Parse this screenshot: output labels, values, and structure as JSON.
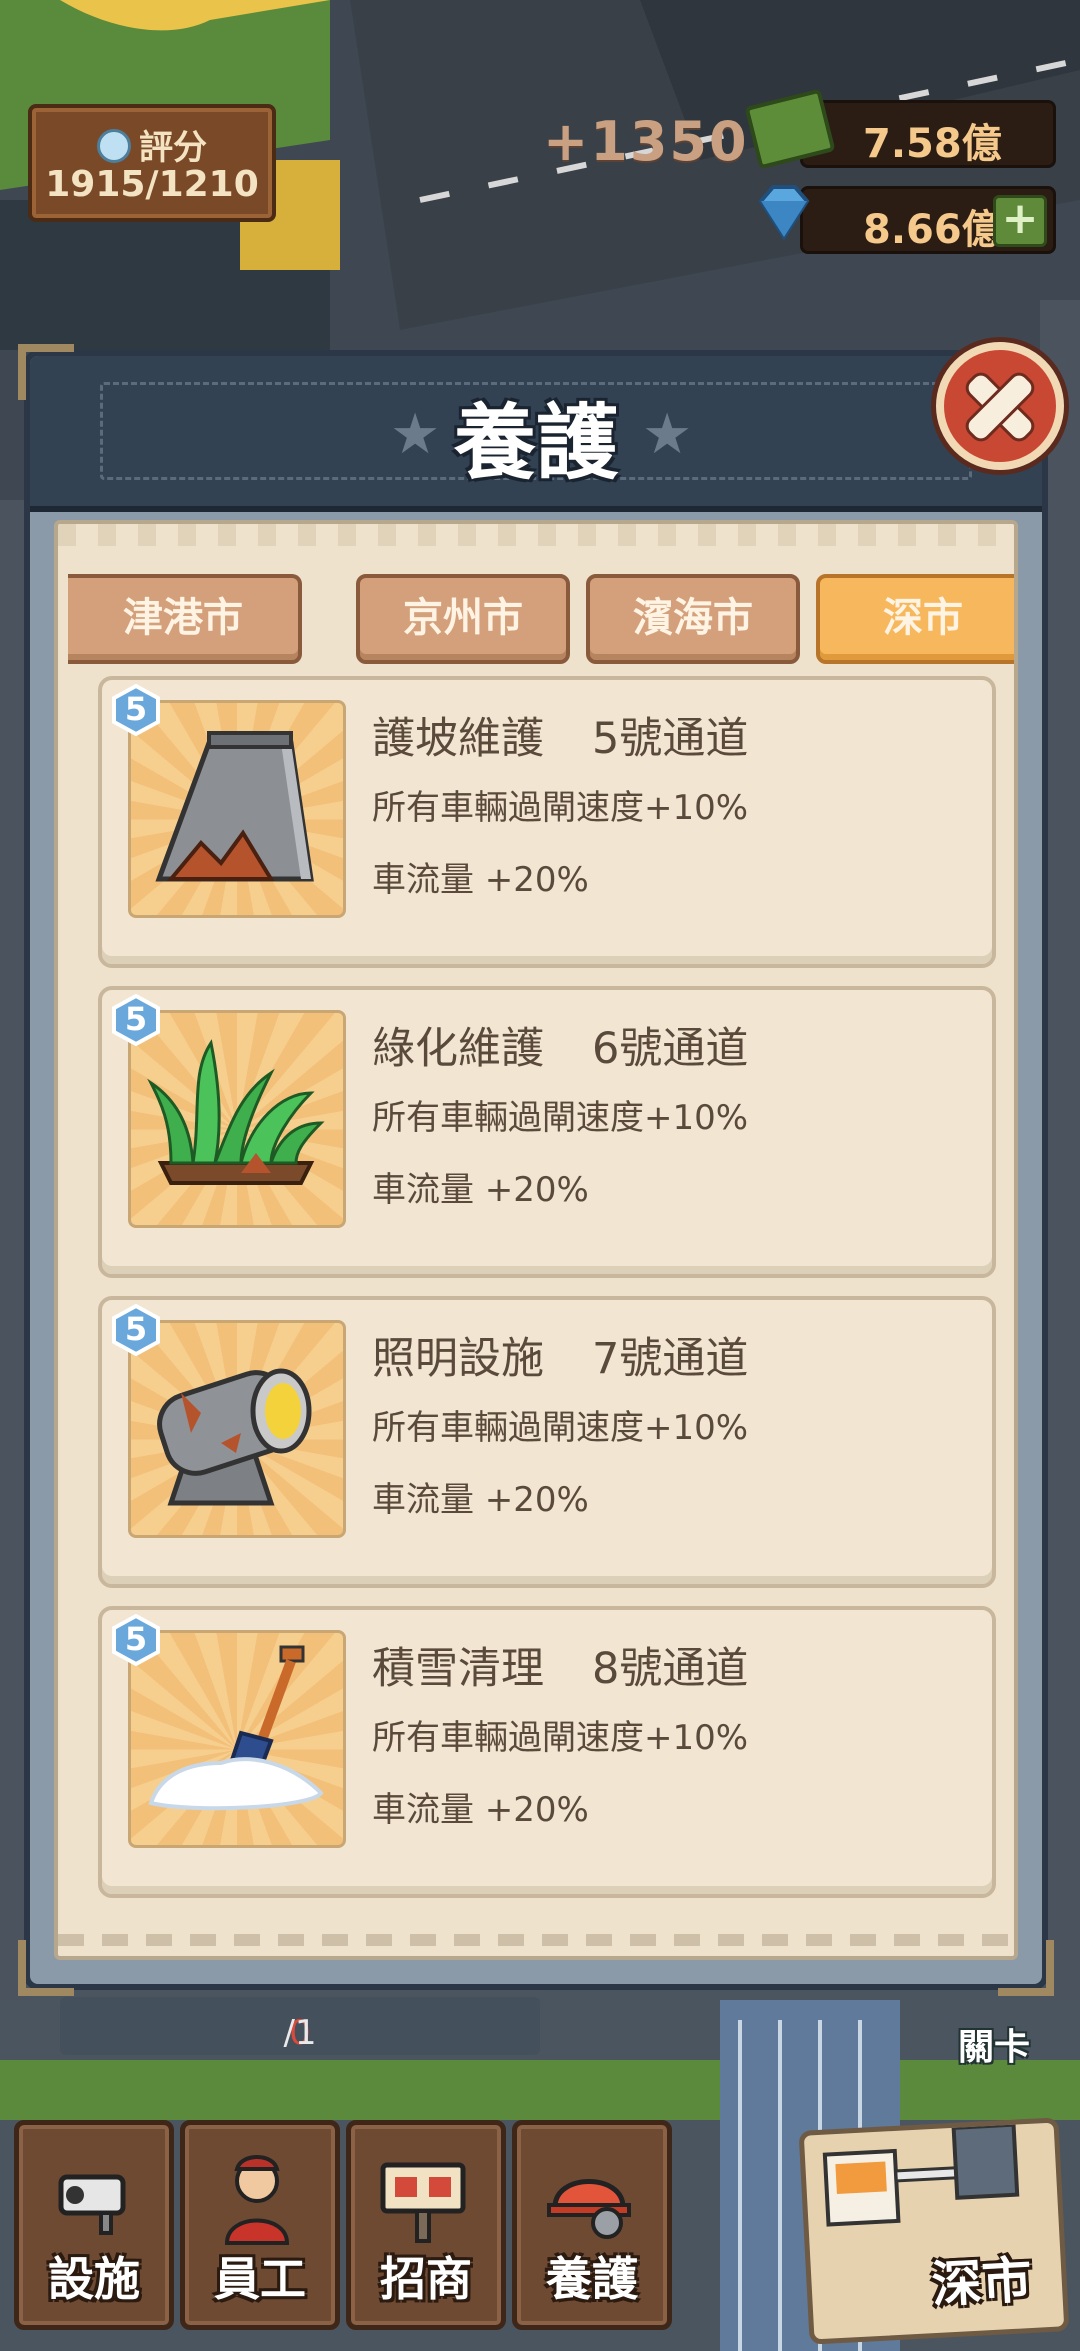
{
  "hud": {
    "score_label": "評分",
    "score_value": "1915/1210",
    "gain": "+1350",
    "cash": "7.58億",
    "diamonds": "8.66億",
    "add_label": "+"
  },
  "modal": {
    "title": "養護",
    "tabs": [
      {
        "label": "津港市",
        "active": false
      },
      {
        "label": "京州市",
        "active": false
      },
      {
        "label": "濱海市",
        "active": false
      },
      {
        "label": "深市",
        "active": true
      }
    ],
    "items": [
      {
        "level": "5",
        "name": "護坡維護",
        "channel": "5號通道",
        "effect1": "所有車輛過閘速度+10%",
        "effect2": "車流量 +20%",
        "icon": "slope-protection-icon"
      },
      {
        "level": "5",
        "name": "綠化維護",
        "channel": "6號通道",
        "effect1": "所有車輛過閘速度+10%",
        "effect2": "車流量 +20%",
        "icon": "grass-icon"
      },
      {
        "level": "5",
        "name": "照明設施",
        "channel": "7號通道",
        "effect1": "所有車輛過閘速度+10%",
        "effect2": "車流量 +20%",
        "icon": "spotlight-icon"
      },
      {
        "level": "5",
        "name": "積雪清理",
        "channel": "8號通道",
        "effect1": "所有車輛過閘速度+10%",
        "effect2": "車流量 +20%",
        "icon": "snow-shovel-icon"
      }
    ]
  },
  "bottom": {
    "progress_current": "0",
    "progress_total": "/1",
    "level_label": "關卡",
    "nav": [
      {
        "label": "設施",
        "icon": "camera-icon"
      },
      {
        "label": "員工",
        "icon": "staff-icon"
      },
      {
        "label": "招商",
        "icon": "signboard-icon"
      },
      {
        "label": "養護",
        "icon": "helmet-wrench-icon"
      }
    ],
    "city_label": "深市"
  }
}
